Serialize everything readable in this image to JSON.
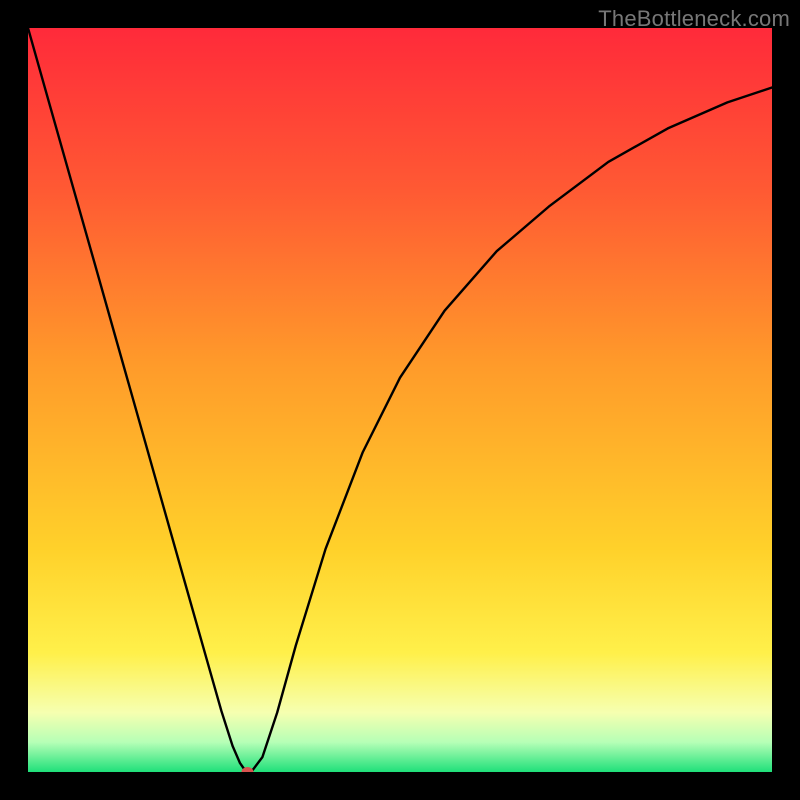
{
  "watermark": "TheBottleneck.com",
  "colors": {
    "frame_border": "#000000",
    "curve_stroke": "#000000",
    "marker_fill": "#d9534f",
    "gradient": {
      "c0": "#ff2a3a",
      "c1": "#ff5a33",
      "c2": "#ff9a2a",
      "c3": "#ffd12a",
      "c4": "#fff04a",
      "c5": "#f6ffb0",
      "c6": "#b6ffb6",
      "c7": "#1fe07a"
    }
  },
  "chart_data": {
    "type": "line",
    "title": "",
    "xlabel": "",
    "ylabel": "",
    "xlim": [
      0,
      1
    ],
    "ylim": [
      0,
      1
    ],
    "note": "Axes are unitless (no tick labels visible). y=0 is at the bottom (green region), y=1 at the top (red). x increases left→right. Curve estimated from pixel positions.",
    "minimum_marker": {
      "x": 0.295,
      "y": 0.0
    },
    "series": [
      {
        "name": "curve",
        "x": [
          0.0,
          0.03,
          0.06,
          0.09,
          0.12,
          0.15,
          0.18,
          0.21,
          0.24,
          0.26,
          0.275,
          0.285,
          0.292,
          0.3,
          0.315,
          0.335,
          0.36,
          0.4,
          0.45,
          0.5,
          0.56,
          0.63,
          0.7,
          0.78,
          0.86,
          0.94,
          1.0
        ],
        "y": [
          1.0,
          0.894,
          0.788,
          0.682,
          0.576,
          0.47,
          0.364,
          0.258,
          0.152,
          0.082,
          0.035,
          0.012,
          0.002,
          0.0,
          0.02,
          0.08,
          0.17,
          0.3,
          0.43,
          0.53,
          0.62,
          0.7,
          0.76,
          0.82,
          0.865,
          0.9,
          0.92
        ]
      }
    ]
  }
}
